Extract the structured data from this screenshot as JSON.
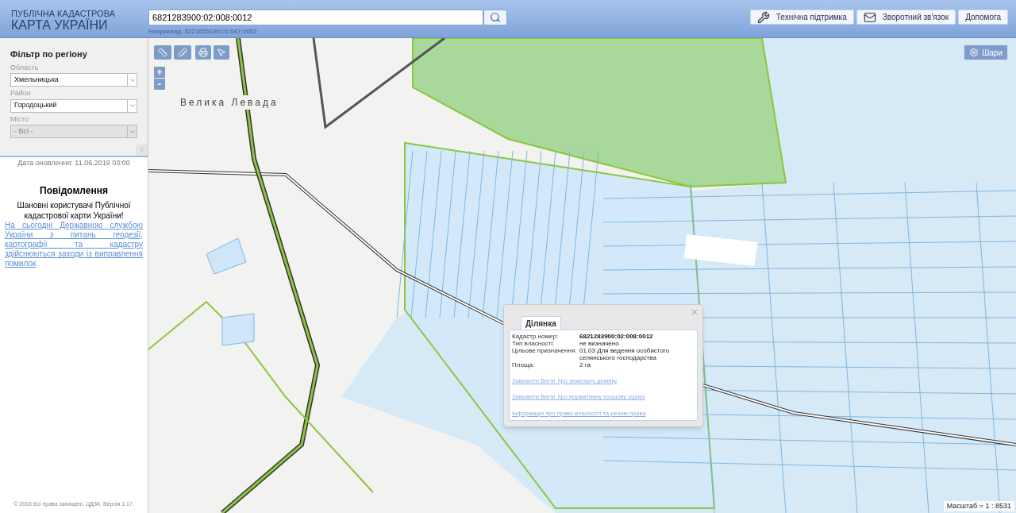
{
  "header": {
    "logo_line_1": "ПУБЛІЧНА КАДАСТРОВА",
    "logo_line_2": "КАРТА УКРАЇНИ",
    "search": {
      "value": "6821283900:02:008:0012",
      "hint": "Наприклад, 3221655100:01:047:0052"
    },
    "buttons": [
      {
        "label": "Технічна підтримка",
        "kind": "tools"
      },
      {
        "label": "Зворотний зв'язок",
        "kind": "mail"
      },
      {
        "label": "Допомога",
        "kind": "plain"
      }
    ]
  },
  "sidebar": {
    "filter_title": "Фільтр по регіону",
    "fields": [
      {
        "label": "Область",
        "value": "Хмельницька",
        "disabled": false
      },
      {
        "label": "Район",
        "value": "Городоцький",
        "disabled": false
      },
      {
        "label": "Місто",
        "value": "- Всі -",
        "disabled": true
      }
    ],
    "update_date": "Дата оновлення: 11.06.2019 03:00",
    "notice_title": "Повідомлення",
    "notice_greeting": "Шановні користувачі Публічної кадастрової карти України!",
    "notice_link": "На сьогодні Державною службою України з питань геодезії, картографії та кадастру здійснюються заходи із виправлення помилок",
    "copyright": "© 2016 Всі права захищені. ЦДЗК. Версія 1.17."
  },
  "map": {
    "place_label": "Велика Левада",
    "zoom_in": "+",
    "zoom_out": "-",
    "layers_button": "Шари",
    "scale": "Масштаб = 1 : 8531"
  },
  "popup": {
    "tab": "Ділянка",
    "rows": [
      {
        "label": "Кадастр.номер:",
        "value": "6821283900:02:008:0012",
        "bold": true
      },
      {
        "label": "Тип власності:",
        "value": "не визначено",
        "bold": false
      },
      {
        "label": "Цільове призначення:",
        "value": "01.03 Для ведення особистого селянського господарства",
        "bold": false
      },
      {
        "label": "Площа:",
        "value": "2 га",
        "bold": false
      }
    ],
    "links": [
      "Замовити Витяг про земельну ділянку",
      "Замовити Витяг про нормативну грошову оцінку",
      "Інформація про право власності та речові права"
    ]
  }
}
